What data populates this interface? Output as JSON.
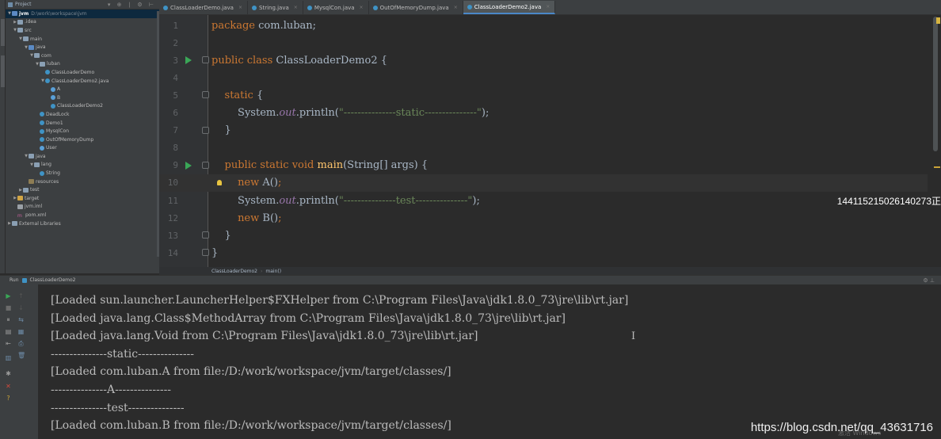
{
  "project_panel": {
    "title": "Project",
    "tree": [
      {
        "indent": 0,
        "arrow": "▼",
        "icon": "folder-src",
        "label": "jvm",
        "sub": "D:\\work\\workspace\\jvm",
        "selected": true
      },
      {
        "indent": 1,
        "arrow": "▶",
        "icon": "folder",
        "label": ".idea"
      },
      {
        "indent": 1,
        "arrow": "▼",
        "icon": "folder",
        "label": "src"
      },
      {
        "indent": 2,
        "arrow": "▼",
        "icon": "folder",
        "label": "main"
      },
      {
        "indent": 3,
        "arrow": "▼",
        "icon": "folder-src",
        "label": "java"
      },
      {
        "indent": 4,
        "arrow": "▼",
        "icon": "folder",
        "label": "com"
      },
      {
        "indent": 5,
        "arrow": "▼",
        "icon": "folder",
        "label": "luban"
      },
      {
        "indent": 6,
        "arrow": "",
        "icon": "cls",
        "label": "ClassLoaderDemo"
      },
      {
        "indent": 6,
        "arrow": "▼",
        "icon": "cls",
        "label": "ClassLoaderDemo2.java"
      },
      {
        "indent": 7,
        "arrow": "",
        "icon": "cls-b",
        "label": "A"
      },
      {
        "indent": 7,
        "arrow": "",
        "icon": "cls-b",
        "label": "B"
      },
      {
        "indent": 7,
        "arrow": "",
        "icon": "cls",
        "label": "ClassLoaderDemo2"
      },
      {
        "indent": 5,
        "arrow": "",
        "icon": "cls",
        "label": "DeadLock"
      },
      {
        "indent": 5,
        "arrow": "",
        "icon": "cls",
        "label": "Demo1"
      },
      {
        "indent": 5,
        "arrow": "",
        "icon": "cls",
        "label": "MysqlCon"
      },
      {
        "indent": 5,
        "arrow": "",
        "icon": "cls",
        "label": "OutOfMemoryDump"
      },
      {
        "indent": 5,
        "arrow": "",
        "icon": "cls-b",
        "label": "User"
      },
      {
        "indent": 3,
        "arrow": "▼",
        "icon": "folder",
        "label": "java"
      },
      {
        "indent": 4,
        "arrow": "▼",
        "icon": "folder",
        "label": "lang"
      },
      {
        "indent": 5,
        "arrow": "",
        "icon": "cls",
        "label": "String"
      },
      {
        "indent": 3,
        "arrow": "",
        "icon": "folder-res",
        "label": "resources"
      },
      {
        "indent": 2,
        "arrow": "▶",
        "icon": "folder",
        "label": "test"
      },
      {
        "indent": 1,
        "arrow": "▶",
        "icon": "folder-target",
        "label": "target"
      },
      {
        "indent": 1,
        "arrow": "",
        "icon": "file",
        "label": "jvm.iml"
      },
      {
        "indent": 1,
        "arrow": "",
        "icon": "maven",
        "label": "pom.xml"
      },
      {
        "indent": 0,
        "arrow": "▶",
        "icon": "folder",
        "label": "External Libraries"
      }
    ]
  },
  "tabs": [
    {
      "label": "ClassLoaderDemo.java",
      "active": false
    },
    {
      "label": "String.java",
      "active": false
    },
    {
      "label": "MysqlCon.java",
      "active": false
    },
    {
      "label": "OutOfMemoryDump.java",
      "active": false
    },
    {
      "label": "ClassLoaderDemo2.java",
      "active": true
    }
  ],
  "editor": {
    "lines": [
      {
        "n": "1",
        "tokens": [
          [
            "kw",
            "package "
          ],
          [
            "",
            "com.luban;"
          ]
        ]
      },
      {
        "n": "2",
        "tokens": []
      },
      {
        "n": "3",
        "run": true,
        "fold": true,
        "tokens": [
          [
            "kw",
            "public class "
          ],
          [
            "",
            "ClassLoaderDemo2 {"
          ]
        ]
      },
      {
        "n": "4",
        "tokens": []
      },
      {
        "n": "5",
        "fold": true,
        "tokens": [
          [
            "",
            "    "
          ],
          [
            "kw",
            "static "
          ],
          [
            "",
            "{"
          ]
        ]
      },
      {
        "n": "6",
        "tokens": [
          [
            "",
            "        System."
          ],
          [
            "it",
            "out"
          ],
          [
            "",
            ".println("
          ],
          [
            "str",
            "\"---------------static---------------\""
          ],
          [
            "",
            ");"
          ]
        ]
      },
      {
        "n": "7",
        "fold": true,
        "tokens": [
          [
            "",
            "    }"
          ]
        ]
      },
      {
        "n": "8",
        "tokens": []
      },
      {
        "n": "9",
        "run": true,
        "fold": true,
        "tokens": [
          [
            "",
            "    "
          ],
          [
            "kw",
            "public static void "
          ],
          [
            "fn",
            "main"
          ],
          [
            "",
            "(String[] args) {"
          ]
        ]
      },
      {
        "n": "10",
        "highlight": true,
        "bulb": true,
        "tokens": [
          [
            "",
            "        "
          ],
          [
            "kw",
            "new "
          ],
          [
            "",
            "A()"
          ],
          [
            "kw",
            ";"
          ]
        ]
      },
      {
        "n": "11",
        "tokens": [
          [
            "",
            "        System."
          ],
          [
            "it",
            "out"
          ],
          [
            "",
            ".println("
          ],
          [
            "str",
            "\"---------------test---------------\""
          ],
          [
            "",
            ");"
          ]
        ]
      },
      {
        "n": "12",
        "tokens": [
          [
            "",
            "        "
          ],
          [
            "kw",
            "new "
          ],
          [
            "",
            "B()"
          ],
          [
            "kw",
            ";"
          ]
        ]
      },
      {
        "n": "13",
        "fold": true,
        "tokens": [
          [
            "",
            "    }"
          ]
        ]
      },
      {
        "n": "14",
        "fold": true,
        "tokens": [
          [
            "",
            "}"
          ]
        ]
      }
    ],
    "breadcrumb": [
      "ClassLoaderDemo2",
      "main()"
    ],
    "overlay_text": "144115215026140273正"
  },
  "run": {
    "label": "Run",
    "config": "ClassLoaderDemo2",
    "console_lines": [
      "[Loaded sun.launcher.LauncherHelper$FXHelper from C:\\Program Files\\Java\\jdk1.8.0_73\\jre\\lib\\rt.jar]",
      "[Loaded java.lang.Class$MethodArray from C:\\Program Files\\Java\\jdk1.8.0_73\\jre\\lib\\rt.jar]",
      "[Loaded java.lang.Void from C:\\Program Files\\Java\\jdk1.8.0_73\\jre\\lib\\rt.jar]",
      "---------------static---------------",
      "[Loaded com.luban.A from file:/D:/work/workspace/jvm/target/classes/]",
      "---------------A---------------",
      "---------------test---------------",
      "[Loaded com.luban.B from file:/D:/work/workspace/jvm/target/classes/]"
    ],
    "cursor_glyph": "I"
  },
  "watermark": "https://blog.csdn.net/qq_43631716",
  "activate_windows": "激活 Windows",
  "colors": {
    "keyword": "#cc7832",
    "string": "#6a8759",
    "static_field": "#9876aa",
    "method": "#ffc66d",
    "run_icon": "#3aa757"
  }
}
